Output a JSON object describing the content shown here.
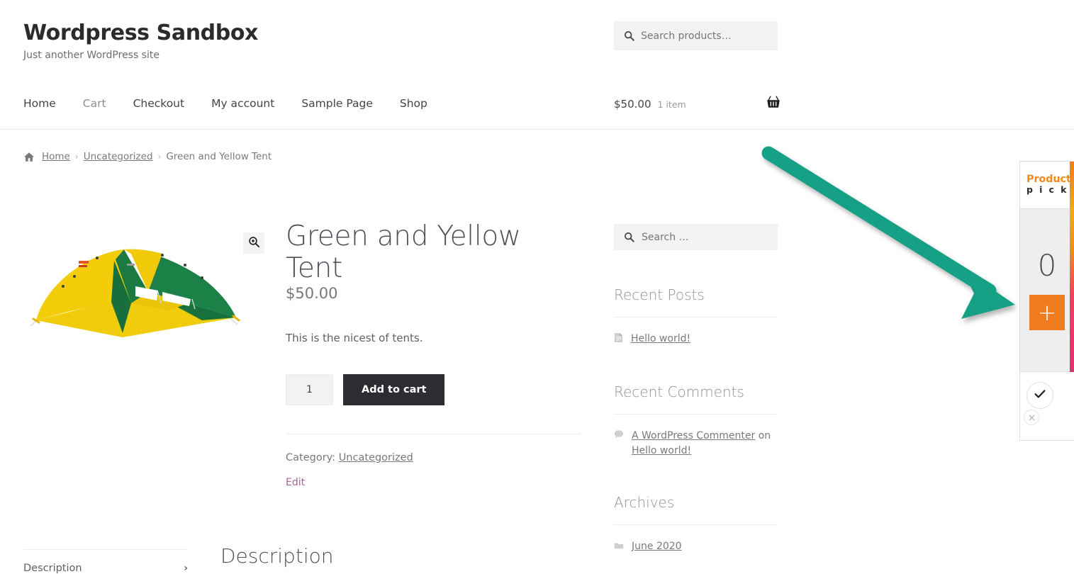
{
  "header": {
    "site_title": "Wordpress Sandbox",
    "tagline": "Just another WordPress site",
    "nav": [
      {
        "label": "Home",
        "name": "nav-home"
      },
      {
        "label": "Cart",
        "name": "nav-cart"
      },
      {
        "label": "Checkout",
        "name": "nav-checkout"
      },
      {
        "label": "My account",
        "name": "nav-my-account"
      },
      {
        "label": "Sample Page",
        "name": "nav-sample-page"
      },
      {
        "label": "Shop",
        "name": "nav-shop"
      }
    ],
    "product_search_placeholder": "Search products…",
    "cart": {
      "amount": "$50.00",
      "count": "1 item",
      "icon": "shopping-basket-icon"
    }
  },
  "breadcrumb": {
    "home_icon": "home-icon",
    "items": [
      {
        "label": "Home",
        "link": true
      },
      {
        "label": "Uncategorized",
        "link": true
      },
      {
        "label": "Green and Yellow Tent",
        "link": false
      }
    ],
    "separator": "›"
  },
  "product": {
    "title": "Green and Yellow Tent",
    "price": "$50.00",
    "short_description": "This is the nicest of tents.",
    "quantity_value": "1",
    "add_to_cart_label": "Add to cart",
    "category_label": "Category:",
    "category_value": "Uncategorized",
    "edit_label": "Edit",
    "zoom_icon": "magnifier-plus-icon",
    "image_alt": "green-and-yellow-tent-image"
  },
  "tabs": {
    "description_tab_label": "Description",
    "chevron": "›",
    "description_heading": "Description"
  },
  "sidebar": {
    "search_placeholder": "Search …",
    "widgets": [
      {
        "title": "Recent Posts",
        "items": [
          {
            "icon": "document-icon",
            "parts": [
              {
                "text": "Hello world!",
                "link": true
              }
            ]
          }
        ]
      },
      {
        "title": "Recent Comments",
        "items": [
          {
            "icon": "comment-icon",
            "parts": [
              {
                "text": "A WordPress Commenter",
                "link": true
              },
              {
                "text": " on ",
                "link": false
              },
              {
                "text": "Hello world!",
                "link": true
              }
            ]
          }
        ]
      },
      {
        "title": "Archives",
        "items": [
          {
            "icon": "folder-icon",
            "parts": [
              {
                "text": "June 2020",
                "link": true
              }
            ]
          }
        ]
      }
    ]
  },
  "product_picker": {
    "brand_line1": "Product",
    "brand_line2": "p i c k e r",
    "count": "0",
    "add_label": "+",
    "confirm_icon": "check-icon",
    "cancel_icon": "close-circle-icon",
    "colors": {
      "brand_orange": "#f08a1e",
      "add_button": "#ef7c1f",
      "stripe_start": "#f07c1c",
      "stripe_end": "#d42d7d"
    }
  },
  "annotation": {
    "arrow_color": "#13a085",
    "points_to": "product-picker-add-button"
  }
}
